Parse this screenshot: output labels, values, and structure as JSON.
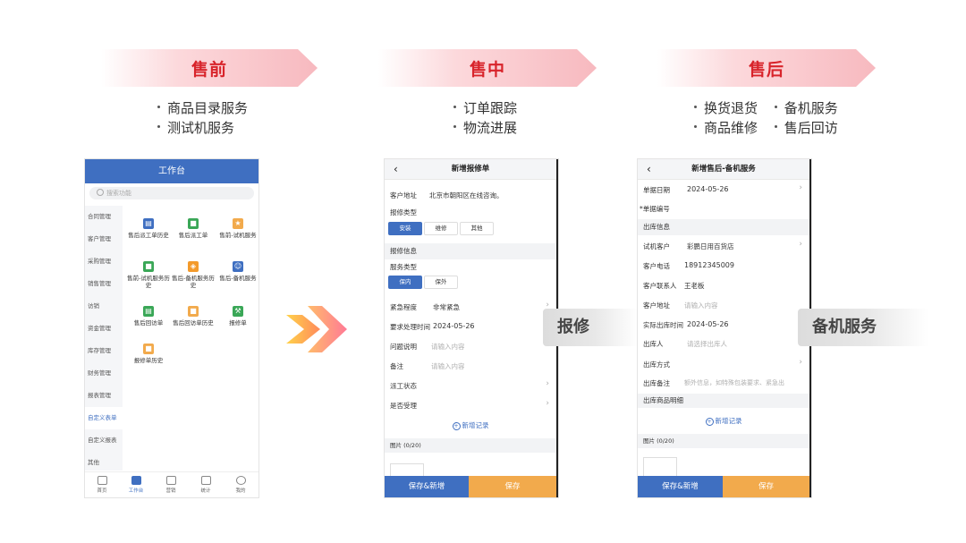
{
  "stages": [
    {
      "title": "售前",
      "bullets": [
        "商品目录服务",
        "测试机服务"
      ]
    },
    {
      "title": "售中",
      "bullets": [
        "订单跟踪",
        "物流进展"
      ]
    },
    {
      "title": "售后",
      "bullets": [
        "换货退货",
        "备机服务",
        "商品维修",
        "售后回访"
      ]
    }
  ],
  "colors": {
    "banner_text": "#d8242b",
    "primary": "#3f6fc1",
    "accent": "#f2aa4c"
  },
  "screen1": {
    "title": "工作台",
    "search_placeholder": "搜索功能",
    "sidebar": [
      "合同管理",
      "客户管理",
      "采购管理",
      "销售管理",
      "访销",
      "资金管理",
      "库存管理",
      "财务管理",
      "报表管理",
      "自定义表单",
      "自定义报表",
      "其他"
    ],
    "grid": [
      {
        "label": "售后派工单历史",
        "icon": "chart-icon",
        "color": "#3f6fc1"
      },
      {
        "label": "售后派工单",
        "icon": "doc-icon",
        "color": "#3aa757"
      },
      {
        "label": "售前-试机服务",
        "icon": "medal-icon",
        "color": "#f2aa4c"
      },
      {
        "label": "售前-试机服务历史",
        "icon": "doc-icon",
        "color": "#3aa757"
      },
      {
        "label": "售后-备机服务历史",
        "icon": "box-icon",
        "color": "#f39a2b"
      },
      {
        "label": "售后-备机服务",
        "icon": "person-icon",
        "color": "#3f6fc1"
      },
      {
        "label": "售后回访单",
        "icon": "chart-icon",
        "color": "#3aa757"
      },
      {
        "label": "售后回访单历史",
        "icon": "doc-icon",
        "color": "#f2aa4c"
      },
      {
        "label": "报修单",
        "icon": "tool-icon",
        "color": "#3aa757"
      },
      {
        "label": "报修单历史",
        "icon": "doc-icon",
        "color": "#f2aa4c"
      }
    ],
    "tabs": [
      "首页",
      "工作台",
      "营销",
      "统计",
      "我的"
    ]
  },
  "screen2": {
    "title": "新增报修单",
    "address_label": "客户地址",
    "address_value": "北京市朝阳区在线咨询。",
    "repair_type_label": "报修类型",
    "repair_types": [
      "安装",
      "维修",
      "其他"
    ],
    "section_info": "报修信息",
    "service_type_label": "服务类型",
    "service_types": [
      "保内",
      "保外"
    ],
    "urgency_label": "紧急程度",
    "urgency_value": "非常紧急",
    "deadline_label": "要求处理时间",
    "deadline_value": "2024-05-26",
    "problem_label": "问题说明",
    "problem_placeholder": "请输入内容",
    "remark_label": "备注",
    "remark_placeholder": "请输入内容",
    "dispatch_label": "派工状态",
    "accept_label": "是否受理",
    "add_record": "新增记录",
    "images_label": "图片 (0/20)",
    "save_new": "保存&新增",
    "save": "保存"
  },
  "tag_repair": "报修",
  "screen3": {
    "title": "新增售后-备机服务",
    "date_label": "单据日期",
    "date_value": "2024-05-26",
    "code_label": "单据编号",
    "section_outbound": "出库信息",
    "customer_label": "试机客户",
    "customer_value": "彩鹏日用百货店",
    "phone_label": "客户电话",
    "phone_value": "18912345009",
    "contact_label": "客户联系人",
    "contact_value": "王老板",
    "address_label": "客户地址",
    "address_placeholder": "请输入内容",
    "outtime_label": "实际出库时间",
    "outtime_value": "2024-05-26",
    "outperson_label": "出库人",
    "outperson_placeholder": "请选择出库人",
    "outmethod_label": "出库方式",
    "outremark_label": "出库备注",
    "outremark_placeholder": "额外信息，如特殊包装要求、紧急出",
    "section_detail": "出库商品明细",
    "add_record": "新增记录",
    "images_label": "图片 (0/20)",
    "save_new": "保存&新增",
    "save": "保存"
  },
  "tag_backup": "备机服务"
}
